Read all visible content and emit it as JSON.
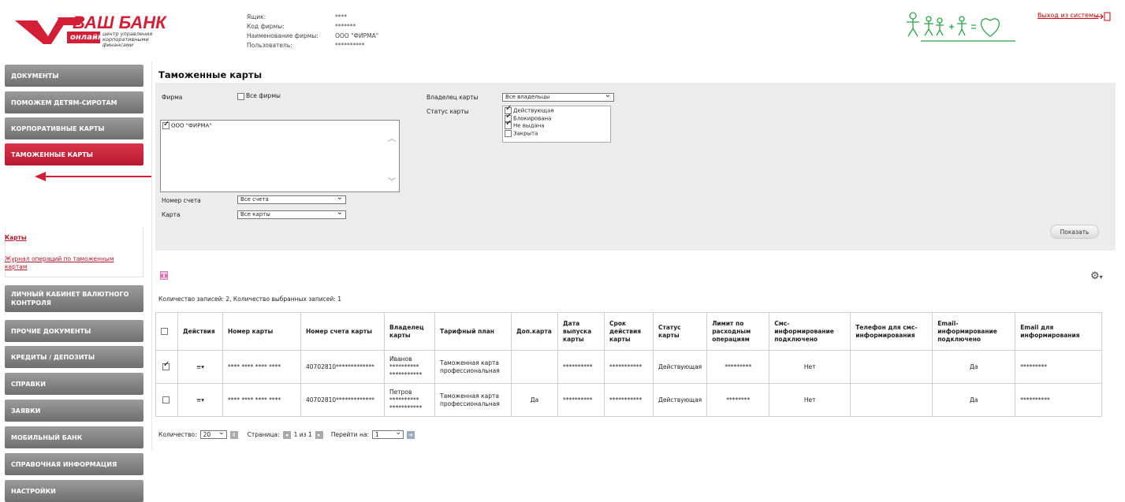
{
  "header": {
    "logo_main": "ВАШ БАНК",
    "logo_sub": "онлайн",
    "logo_desc": "центр управления корпоративными финансами",
    "meta": [
      {
        "k": "Ящик:",
        "v": "****"
      },
      {
        "k": "Код фирмы:",
        "v": "*******"
      },
      {
        "k": "Наименование фирмы:",
        "v": "ООО \"ФИРМА\""
      },
      {
        "k": "Пользователь:",
        "v": "**********"
      }
    ],
    "logout": "Выход из системы"
  },
  "sidebar": {
    "items": [
      "ДОКУМЕНТЫ",
      "ПОМОЖЕМ ДЕТЯМ-СИРОТАМ",
      "КОРПОРАТИВНЫЕ КАРТЫ",
      "ТАМОЖЕННЫЕ КАРТЫ",
      "ЛИЧНЫЙ КАБИНЕТ ВАЛЮТНОГО КОНТРОЛЯ",
      "ПРОЧИЕ ДОКУМЕНТЫ",
      "КРЕДИТЫ / ДЕПОЗИТЫ",
      "СПРАВКИ",
      "ЗАЯВКИ",
      "МОБИЛЬНЫЙ БАНК",
      "СПРАВОЧНАЯ ИНФОРМАЦИЯ",
      "НАСТРОЙКИ"
    ],
    "sub": [
      "Карты",
      "Журнал операций по таможенным картам"
    ]
  },
  "page": {
    "title": "Таможенные карты"
  },
  "filters": {
    "firm_label": "Фирма",
    "all_firms": "Все фирмы",
    "firm_option": "ООО \"ФИРМА\"",
    "account_label": "Номер счета",
    "account_value": "Все счета",
    "card_label": "Карта",
    "card_value": "Все карты",
    "owner_label": "Владелец карты",
    "owner_value": "Все владельцы",
    "status_label": "Статус карты",
    "statuses": [
      {
        "label": "Действующая",
        "checked": true
      },
      {
        "label": "Блокирована",
        "checked": true
      },
      {
        "label": "Не выдана",
        "checked": true
      },
      {
        "label": "Закрыта",
        "checked": false
      }
    ],
    "show": "Показать"
  },
  "count_text": "Количество записей: 2, Количество выбранных записей: 1",
  "table": {
    "headers": [
      "Действия",
      "Номер карты",
      "Номер счета карты",
      "Владелец карты",
      "Тарифный план",
      "Доп.карта",
      "Дата выпуска карты",
      "Срок действия карты",
      "Статус карты",
      "Лимит по расходным операциям",
      "Смс-информирование подключено",
      "Телефон для смс-информирования",
      "Email-информирование подключено",
      "Email для информирования"
    ],
    "rows": [
      {
        "checked": true,
        "card": "**** **** **** ****",
        "account": "40702810*************",
        "owner": "Иванов ********** ***********",
        "tariff": "Таможенная карта профессиональная",
        "extra": "",
        "issued": "**********",
        "expiry": "***********",
        "status": "Действующая",
        "limit": "*********",
        "sms": "Нет",
        "phone": "",
        "email_on": "Да",
        "email": "*********"
      },
      {
        "checked": false,
        "card": "**** **** **** ****",
        "account": "40702810*************",
        "owner": "Петров ********** ***********",
        "tariff": "Таможенная карта профессиональная",
        "extra": "Да",
        "issued": "**********",
        "expiry": "***********",
        "status": "Действующая",
        "limit": "********",
        "sms": "Нет",
        "phone": "",
        "email_on": "Да",
        "email": "**********"
      }
    ]
  },
  "pager": {
    "qty_label": "Количество:",
    "qty": "20",
    "page_label": "Страница:",
    "page_text": "1 из 1",
    "goto_label": "Перейти на:",
    "goto": "1"
  }
}
